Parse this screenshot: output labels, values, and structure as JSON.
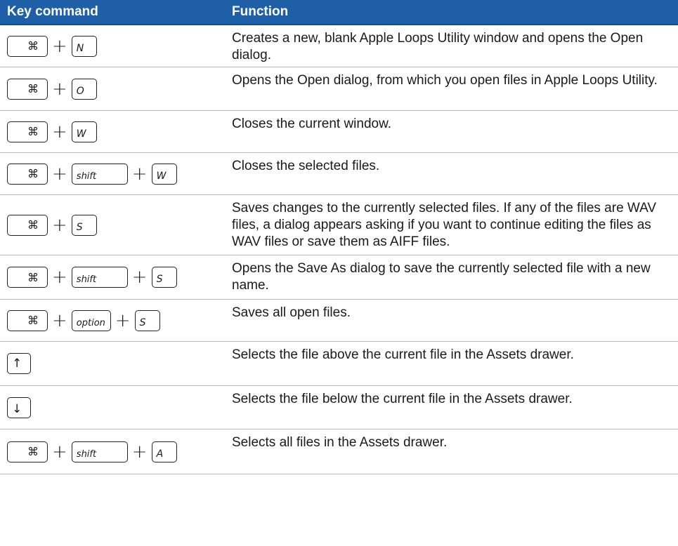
{
  "header": {
    "key_command": "Key command",
    "function": "Function"
  },
  "glyphs": {
    "apple": "",
    "command": "⌘",
    "plus": "+",
    "up": "↑",
    "down": "↓"
  },
  "keys": {
    "N": "N",
    "O": "O",
    "W": "W",
    "S": "S",
    "A": "A",
    "shift": "shift",
    "option": "option"
  },
  "rows": [
    {
      "function": "Creates a new, blank Apple Loops Utility window and opens the Open dialog."
    },
    {
      "function": "Opens the Open dialog, from which you open files in Apple Loops Utility."
    },
    {
      "function": "Closes the current window."
    },
    {
      "function": "Closes the selected files."
    },
    {
      "function": "Saves changes to the currently selected files. If any of the files are WAV files, a dialog appears asking if you want to continue editing the files as WAV files or save them as AIFF files."
    },
    {
      "function": "Opens the Save As dialog to save the currently selected file with a new name."
    },
    {
      "function": "Saves all open files."
    },
    {
      "function": "Selects the file above the current file in the Assets drawer."
    },
    {
      "function": "Selects the file below the current file in the Assets drawer."
    },
    {
      "function": "Selects all files in the Assets drawer."
    }
  ],
  "colors": {
    "header_bg": "#1f5fa8",
    "header_text": "#ffffff",
    "row_divider": "#b8b8b8"
  }
}
